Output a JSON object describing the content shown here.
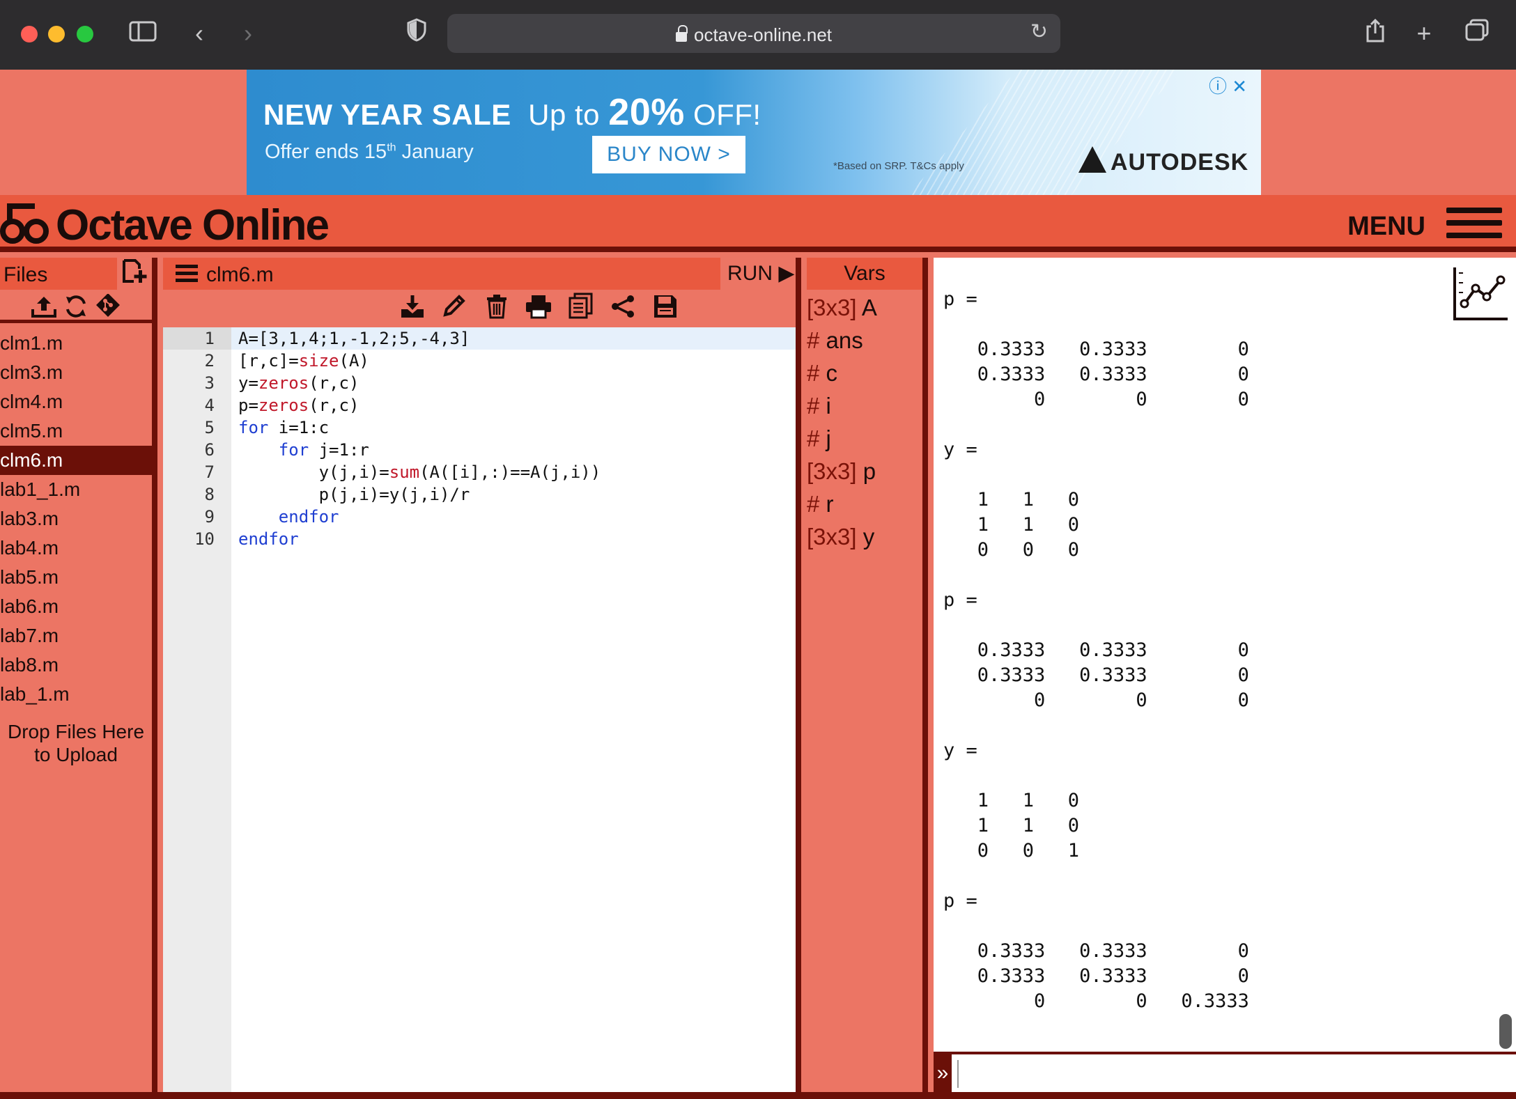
{
  "browser": {
    "url": "octave-online.net",
    "icons": [
      "sidebar-icon",
      "back-icon",
      "forward-icon",
      "shield-icon",
      "reload-icon",
      "share-icon",
      "new-tab-icon",
      "tabs-icon"
    ]
  },
  "ad": {
    "headline_a": "NEW YEAR SALE",
    "headline_b": "Up to",
    "headline_pct": "20%",
    "headline_c": "OFF!",
    "sub_a": "Offer ends 15",
    "sub_sup": "th",
    "sub_b": " January",
    "cta": "BUY NOW >",
    "fine_print": "*Based on SRP. T&Cs apply",
    "brand": "AUTODESK"
  },
  "header": {
    "brand": "Octave Online",
    "menu_label": "MENU"
  },
  "files": {
    "title": "Files",
    "items": [
      "clm1.m",
      "clm3.m",
      "clm4.m",
      "clm5.m",
      "clm6.m",
      "lab1_1.m",
      "lab3.m",
      "lab4.m",
      "lab5.m",
      "lab6.m",
      "lab7.m",
      "lab8.m",
      "lab_1.m"
    ],
    "active_index": 4,
    "drop_line1": "Drop Files Here",
    "drop_line2": "to Upload"
  },
  "editor": {
    "filename": "clm6.m",
    "run_label": "RUN",
    "lines": [
      {
        "n": "1",
        "code": "A=[3,1,4;1,-1,2;5,-4,3]"
      },
      {
        "n": "2",
        "code": "[r,c]=size(A)"
      },
      {
        "n": "3",
        "code": "y=zeros(r,c)"
      },
      {
        "n": "4",
        "code": "p=zeros(r,c)"
      },
      {
        "n": "5",
        "code": "for i=1:c"
      },
      {
        "n": "6",
        "code": "    for j=1:r"
      },
      {
        "n": "7",
        "code": "        y(j,i)=sum(A([i],:)==A(j,i))"
      },
      {
        "n": "8",
        "code": "        p(j,i)=y(j,i)/r"
      },
      {
        "n": "9",
        "code": "    endfor"
      },
      {
        "n": "10",
        "code": "endfor"
      }
    ]
  },
  "vars": {
    "title": "Vars",
    "items": [
      {
        "type": "[3x3]",
        "name": "A"
      },
      {
        "type": "#",
        "name": "ans"
      },
      {
        "type": "#",
        "name": "c"
      },
      {
        "type": "#",
        "name": "i"
      },
      {
        "type": "#",
        "name": "j"
      },
      {
        "type": "[3x3]",
        "name": "p"
      },
      {
        "type": "#",
        "name": "r"
      },
      {
        "type": "[3x3]",
        "name": "y"
      }
    ]
  },
  "console": {
    "output": "p =\n\n   0.3333   0.3333        0\n   0.3333   0.3333        0\n        0        0        0\n\ny =\n\n   1   1   0\n   1   1   0\n   0   0   0\n\np =\n\n   0.3333   0.3333        0\n   0.3333   0.3333        0\n        0        0        0\n\ny =\n\n   1   1   0\n   1   1   0\n   0   0   1\n\np =\n\n   0.3333   0.3333        0\n   0.3333   0.3333        0\n        0        0   0.3333",
    "prompt_symbol": "»",
    "input_value": ""
  },
  "colors": {
    "bg": "#ec7564",
    "header": "#e9593f",
    "border": "#6b1008",
    "keyword": "#1f3fd1",
    "function": "#c0182a"
  }
}
